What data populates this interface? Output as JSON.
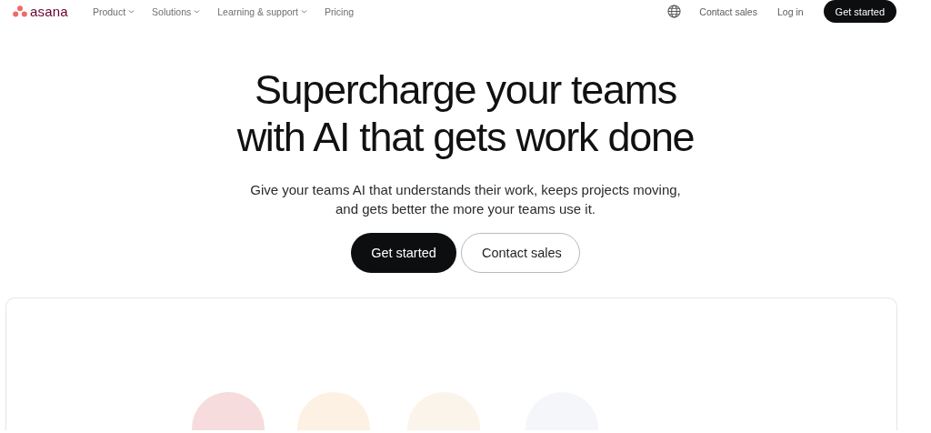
{
  "nav": {
    "logo": "asana",
    "menu": [
      {
        "label": "Product",
        "dropdown": true
      },
      {
        "label": "Solutions",
        "dropdown": true
      },
      {
        "label": "Learning & support",
        "dropdown": true
      },
      {
        "label": "Pricing",
        "dropdown": false
      }
    ],
    "contact": "Contact sales",
    "login": "Log in",
    "cta": "Get started"
  },
  "hero": {
    "title_lines": [
      "Supercharge your teams",
      "with AI that gets work done"
    ],
    "subtitle": "Give your teams AI that understands their work, keeps projects moving, and gets better the more your teams use it.",
    "buttons": [
      {
        "label": "Get started",
        "kind": "primary"
      },
      {
        "label": "Contact sales",
        "kind": "secondary"
      }
    ]
  }
}
